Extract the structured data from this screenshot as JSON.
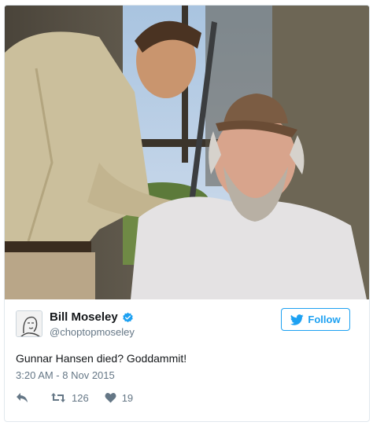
{
  "tweet": {
    "author_name": "Bill Moseley",
    "handle": "@choptopmoseley",
    "follow_label": "Follow",
    "text": "Gunnar Hansen died? Goddammit!",
    "timestamp": "3:20 AM - 8 Nov 2015",
    "retweet_count": "126",
    "like_count": "19"
  },
  "colors": {
    "accent": "#1da1f2",
    "secondary_text": "#657786",
    "border": "#e1e8ed"
  },
  "icons": {
    "verified": "verified-badge-icon",
    "follow": "twitter-bird-icon",
    "reply": "reply-arrow-icon",
    "retweet": "retweet-icon",
    "like": "heart-icon"
  }
}
